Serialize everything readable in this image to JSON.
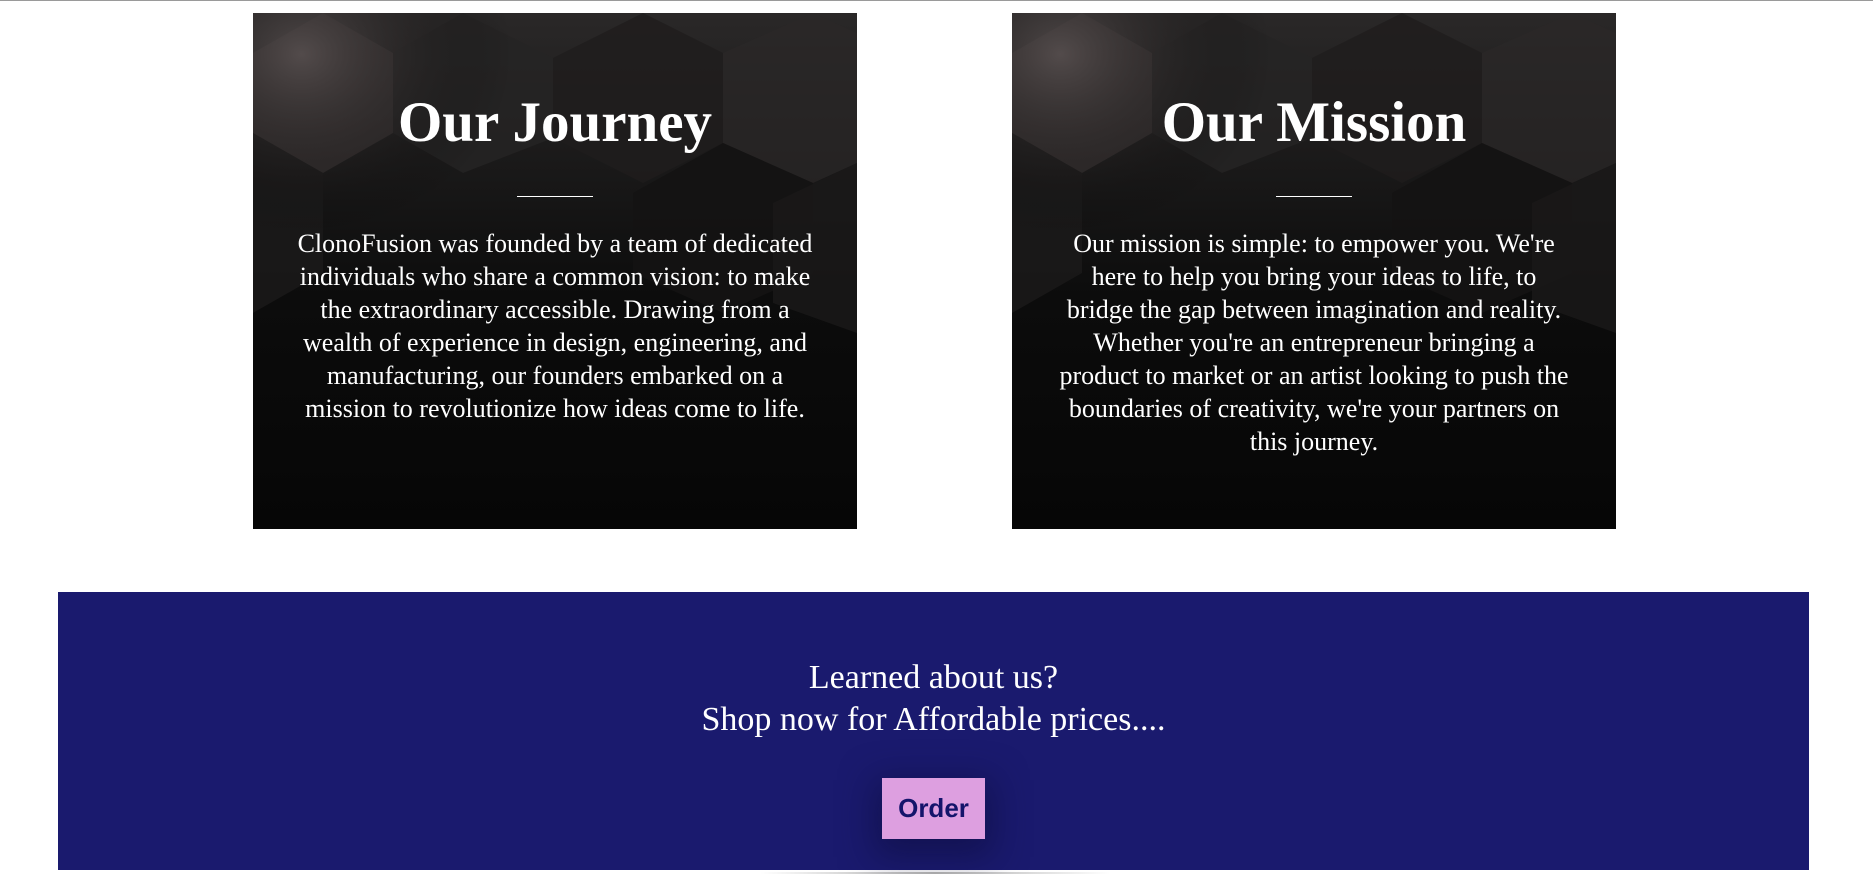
{
  "journey": {
    "title": "Our Journey",
    "text": "ClonoFusion was founded by a team of dedicated individuals who share a common vision: to make the extraordinary accessible. Drawing from a wealth of experience in design, engineering, and manufacturing, our founders embarked on a mission to revolutionize how ideas come to life."
  },
  "mission": {
    "title": "Our Mission",
    "text": "Our mission is simple: to empower you. We're here to help you bring your ideas to life, to bridge the gap between imagination and reality. Whether you're an entrepreneur bringing a product to market or an artist looking to push the boundaries of creativity, we're your partners on this journey."
  },
  "cta": {
    "line1": "Learned about us?",
    "line2": "Shop now for Affordable prices....",
    "order_label": "Order"
  },
  "colors": {
    "cta_background": "#1a1a6e",
    "order_button": "#dd9fe0",
    "order_text": "#14146b",
    "card_background": "#080808"
  }
}
